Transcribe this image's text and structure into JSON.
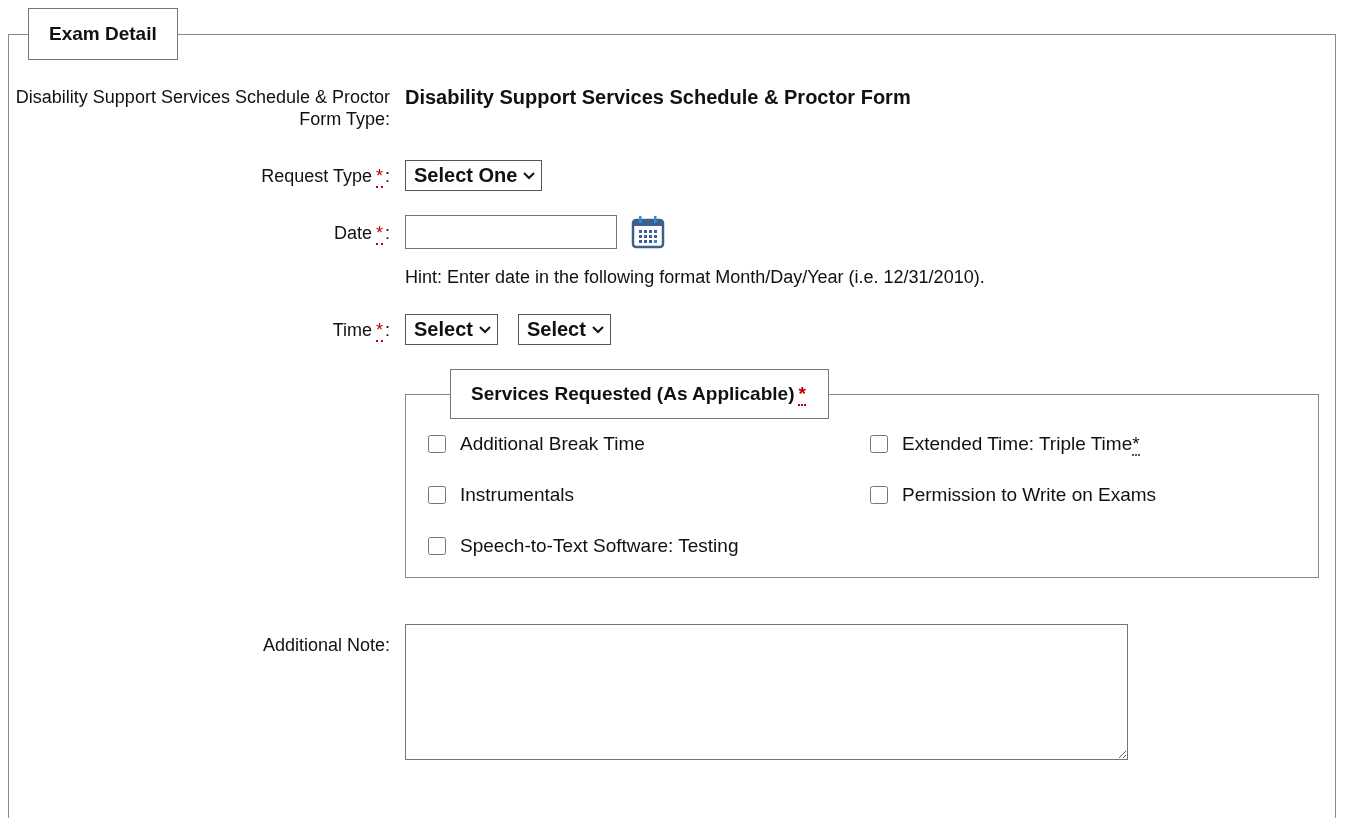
{
  "section": {
    "title": "Exam Detail"
  },
  "required_mark": "*",
  "label_colon": ":",
  "form_type": {
    "label": "Disability Support Services Schedule & Proctor Form Type:",
    "value": "Disability Support Services Schedule & Proctor Form"
  },
  "request_type": {
    "label": "Request Type",
    "required": true,
    "value": "Select One"
  },
  "date": {
    "label": "Date",
    "required": true,
    "hint": "Hint: Enter date in the following format Month/Day/Year (i.e. 12/31/2010)."
  },
  "time": {
    "label": "Time",
    "required": true,
    "selects": [
      "Select",
      "Select"
    ]
  },
  "services": {
    "title": "Services Requested (As Applicable)",
    "required": true,
    "options": [
      {
        "label": "Additional Break Time",
        "checked": false
      },
      {
        "label": "Extended Time: Triple Time",
        "mark": "*",
        "checked": false
      },
      {
        "label": "Instrumentals",
        "checked": false
      },
      {
        "label": "Permission to Write on Exams",
        "checked": false
      },
      {
        "label": "Speech-to-Text Software: Testing",
        "checked": false
      }
    ]
  },
  "note": {
    "label": "Additional Note:"
  }
}
